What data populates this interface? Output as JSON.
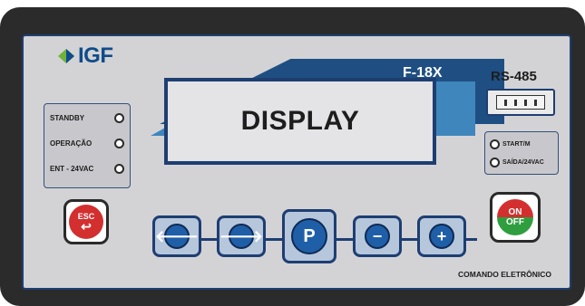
{
  "brand": {
    "name": "IGF",
    "color": "#0f4c8a",
    "accent": "#6fb23c"
  },
  "model": "F-18X",
  "display": {
    "text": "DISPLAY"
  },
  "leds": [
    {
      "label": "STANDBY"
    },
    {
      "label": "OPERAÇÃO"
    },
    {
      "label": "ENT - 24VAC"
    }
  ],
  "rs485": {
    "label": "RS-485",
    "pins": 4
  },
  "status_leds": [
    {
      "label": "START/M"
    },
    {
      "label": "SAÍDA/24VAC"
    }
  ],
  "buttons": {
    "esc": {
      "label": "ESC",
      "icon": "return-arrow-icon",
      "color": "#d32f2f"
    },
    "onoff": {
      "on_label": "ON",
      "off_label": "OFF",
      "on_color": "#d32f2f",
      "off_color": "#2e9e3e"
    },
    "nav": [
      {
        "name": "left-arrow-button",
        "icon": "left-arrow-icon",
        "glyph": "🡐"
      },
      {
        "name": "right-arrow-button",
        "icon": "right-arrow-icon",
        "glyph": "🡒"
      },
      {
        "name": "program-button",
        "icon": "p-icon",
        "glyph": "P"
      },
      {
        "name": "minus-button",
        "icon": "minus-icon",
        "glyph": "−"
      },
      {
        "name": "plus-button",
        "icon": "plus-icon",
        "glyph": "+"
      }
    ]
  },
  "footer": {
    "text": "COMANDO ELETRÔNICO"
  },
  "colors": {
    "bezel": "#2b2b2b",
    "panel": "#d3d3d6",
    "navy": "#1e3e72",
    "blue": "#1f5fa8"
  }
}
